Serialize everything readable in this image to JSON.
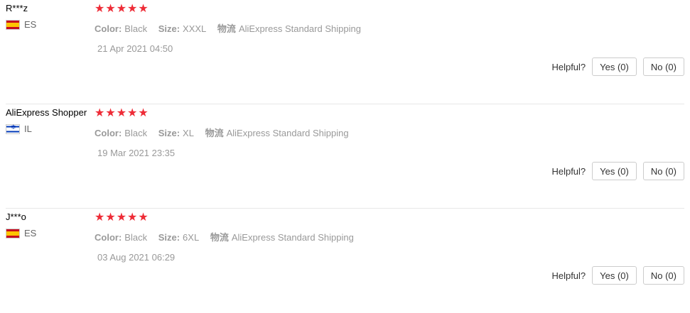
{
  "reviews": [
    {
      "user": "R***z",
      "country": "ES",
      "flag": "es",
      "rating": 5,
      "color_label": "Color:",
      "color": "Black",
      "size_label": "Size:",
      "size": "XXXL",
      "logistics_label": "物流",
      "logistics": "AliExpress Standard Shipping",
      "date": "21 Apr 2021 04:50",
      "helpful_label": "Helpful?",
      "yes": "Yes (0)",
      "no": "No (0)"
    },
    {
      "user": "AliExpress Shopper",
      "country": "IL",
      "flag": "il",
      "rating": 5,
      "color_label": "Color:",
      "color": "Black",
      "size_label": "Size:",
      "size": "XL",
      "logistics_label": "物流",
      "logistics": "AliExpress Standard Shipping",
      "date": "19 Mar 2021 23:35",
      "helpful_label": "Helpful?",
      "yes": "Yes (0)",
      "no": "No (0)"
    },
    {
      "user": "J***o",
      "country": "ES",
      "flag": "es",
      "rating": 5,
      "color_label": "Color:",
      "color": "Black",
      "size_label": "Size:",
      "size": "6XL",
      "logistics_label": "物流",
      "logistics": "AliExpress Standard Shipping",
      "date": "03 Aug 2021 06:29",
      "helpful_label": "Helpful?",
      "yes": "Yes (0)",
      "no": "No (0)"
    }
  ],
  "colors": {
    "star": "#ee2c37",
    "muted": "#999999",
    "divider": "#e8e8e8"
  },
  "icons": {
    "star": "star-icon",
    "flag_es": "spain-flag-icon",
    "flag_il": "israel-flag-icon"
  }
}
